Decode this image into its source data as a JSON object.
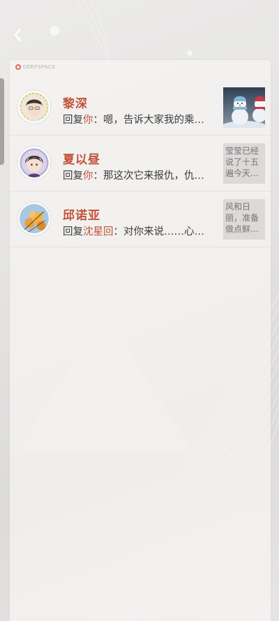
{
  "header": {
    "back_icon": "chevron-left-icon",
    "logo_text": "DEEPSPACE"
  },
  "notifications": [
    {
      "name": "黎深",
      "reply_prefix": "回复",
      "reply_target": "你",
      "reply_text": "：嗯，告诉大家我的乘…",
      "thumb_type": "image",
      "thumb_desc": "snowman-photo",
      "thumb_text": ""
    },
    {
      "name": "夏以昼",
      "reply_prefix": "回复",
      "reply_target": "你",
      "reply_text": "：那这次它来报仇，仇…",
      "thumb_type": "text",
      "thumb_text": "莹莹已经说了十五遍今天…"
    },
    {
      "name": "邱诺亚",
      "reply_prefix": "回复",
      "reply_target": "沈星回",
      "reply_text": "：对你来说……心…",
      "thumb_type": "text",
      "thumb_text": "风和日丽，准备做点鲜…"
    }
  ],
  "colors": {
    "accent": "#c2513a",
    "text": "#3b3b3b",
    "muted": "#767473",
    "background": "#e6e5e4"
  }
}
